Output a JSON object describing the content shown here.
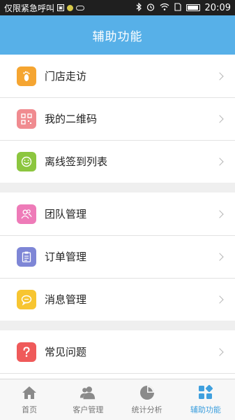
{
  "status_bar": {
    "carrier": "仅限紧急呼叫",
    "time": "20:09",
    "icons": [
      "sim-icon",
      "notification-icon",
      "cloud-icon",
      "bluetooth-icon",
      "alarm-icon",
      "wifi-icon",
      "battery-icon"
    ]
  },
  "header": {
    "title": "辅助功能"
  },
  "menu_groups": [
    {
      "items": [
        {
          "label": "门店走访",
          "icon": "footprint-icon",
          "color": "#f5a531"
        },
        {
          "label": "我的二维码",
          "icon": "qrcode-icon",
          "color": "#f08b90"
        },
        {
          "label": "离线签到列表",
          "icon": "smile-check-icon",
          "color": "#8cc63f"
        }
      ]
    },
    {
      "items": [
        {
          "label": "团队管理",
          "icon": "team-icon",
          "color": "#ee7bb8"
        },
        {
          "label": "订单管理",
          "icon": "clipboard-icon",
          "color": "#7e86d6"
        },
        {
          "label": "消息管理",
          "icon": "message-icon",
          "color": "#f7c531"
        }
      ]
    },
    {
      "items": [
        {
          "label": "常见问题",
          "icon": "question-icon",
          "color": "#ef5a5a"
        }
      ]
    }
  ],
  "bottom_nav": {
    "items": [
      {
        "label": "首页",
        "icon": "home-icon",
        "active": false
      },
      {
        "label": "客户管理",
        "icon": "customers-icon",
        "active": false
      },
      {
        "label": "统计分析",
        "icon": "pie-chart-icon",
        "active": false
      },
      {
        "label": "辅助功能",
        "icon": "grid-icon",
        "active": true
      }
    ],
    "active_color": "#3fa0de",
    "inactive_color": "#777777"
  },
  "colors": {
    "header_bg": "#57b0e8",
    "page_bg": "#efefef"
  }
}
